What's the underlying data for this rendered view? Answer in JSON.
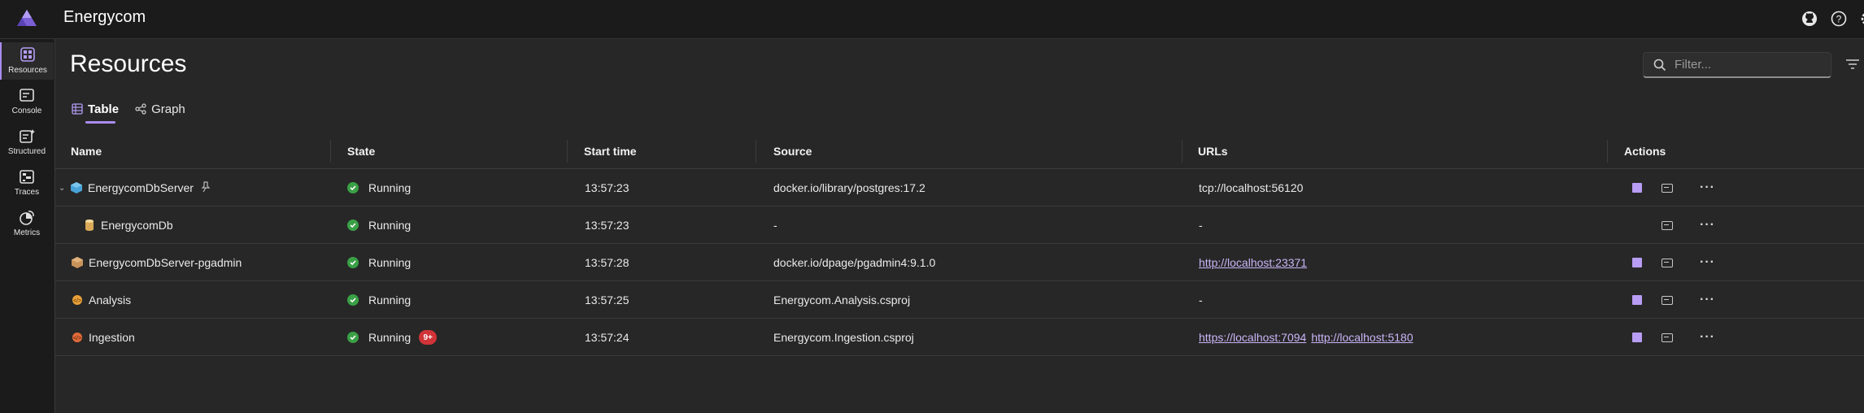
{
  "app": {
    "title": "Energycom",
    "accent": "#a98cf0"
  },
  "topbar": {
    "icons": [
      "github-icon",
      "help-icon",
      "settings-icon"
    ]
  },
  "nav": {
    "items": [
      {
        "label": "Resources",
        "icon": "resources-icon",
        "active": true
      },
      {
        "label": "Console",
        "icon": "console-icon",
        "active": false
      },
      {
        "label": "Structured",
        "icon": "structured-icon",
        "active": false
      },
      {
        "label": "Traces",
        "icon": "traces-icon",
        "active": false
      },
      {
        "label": "Metrics",
        "icon": "metrics-icon",
        "active": false
      }
    ]
  },
  "page": {
    "title": "Resources"
  },
  "filter": {
    "placeholder": "Filter..."
  },
  "tabs": [
    {
      "label": "Table",
      "active": true
    },
    {
      "label": "Graph",
      "active": false
    }
  ],
  "table": {
    "columns": [
      "Name",
      "State",
      "Start time",
      "Source",
      "URLs",
      "Actions"
    ],
    "rows": [
      {
        "name": "EnergycomDbServer",
        "icon": "container-icon",
        "state": "Running",
        "badge": "",
        "start": "13:57:23",
        "source": "docker.io/library/postgres:17.2",
        "urls": [
          "tcp://localhost:56120"
        ],
        "url_links": false
      },
      {
        "name": "EnergycomDb",
        "icon": "database-icon",
        "state": "Running",
        "badge": "",
        "start": "13:57:23",
        "source": "-",
        "urls": [
          "-"
        ],
        "url_links": false
      },
      {
        "name": "EnergycomDbServer-pgadmin",
        "icon": "container-icon",
        "state": "Running",
        "badge": "",
        "start": "13:57:28",
        "source": "docker.io/dpage/pgadmin4:9.1.0",
        "urls": [
          "http://localhost:23371"
        ],
        "url_links": true
      },
      {
        "name": "Analysis",
        "icon": "project-icon",
        "state": "Running",
        "badge": "",
        "start": "13:57:25",
        "source": "Energycom.Analysis.csproj",
        "urls": [
          "-"
        ],
        "url_links": false
      },
      {
        "name": "Ingestion",
        "icon": "project-icon",
        "state": "Running",
        "badge": "9+",
        "start": "13:57:24",
        "source": "Energycom.Ingestion.csproj",
        "urls": [
          "https://localhost:7094",
          "http://localhost:5180"
        ],
        "url_links": true
      }
    ]
  },
  "colors": {
    "running": "#3aa046",
    "badge": "#d13438",
    "link": "#c9b5f7"
  }
}
